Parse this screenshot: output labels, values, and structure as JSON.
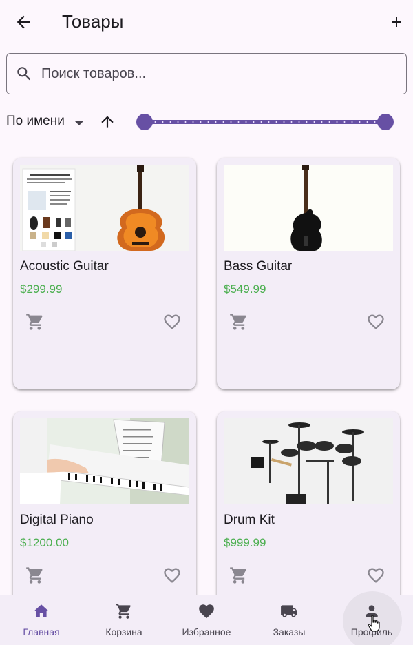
{
  "appbar": {
    "title": "Товары"
  },
  "search": {
    "placeholder": "Поиск товаров..."
  },
  "sort": {
    "selected": "По имени",
    "direction": "ascending",
    "price_range_fraction": [
      0.0,
      1.0
    ]
  },
  "products": [
    {
      "name": "Acoustic Guitar",
      "price": "$299.99"
    },
    {
      "name": "Bass Guitar",
      "price": "$549.99"
    },
    {
      "name": "Digital Piano",
      "price": "$1200.00"
    },
    {
      "name": "Drum Kit",
      "price": "$999.99"
    }
  ],
  "nav": {
    "items": [
      {
        "label": "Главная",
        "icon": "home-icon",
        "active": true
      },
      {
        "label": "Корзина",
        "icon": "cart-icon",
        "active": false
      },
      {
        "label": "Избранное",
        "icon": "heart-icon",
        "active": false
      },
      {
        "label": "Заказы",
        "icon": "truck-icon",
        "active": false
      },
      {
        "label": "Профиль",
        "icon": "person-icon",
        "active": false
      }
    ]
  },
  "colors": {
    "accent": "#6750a4",
    "price": "#4caf50",
    "background": "#fdf7fd",
    "card": "#f3edf7"
  }
}
